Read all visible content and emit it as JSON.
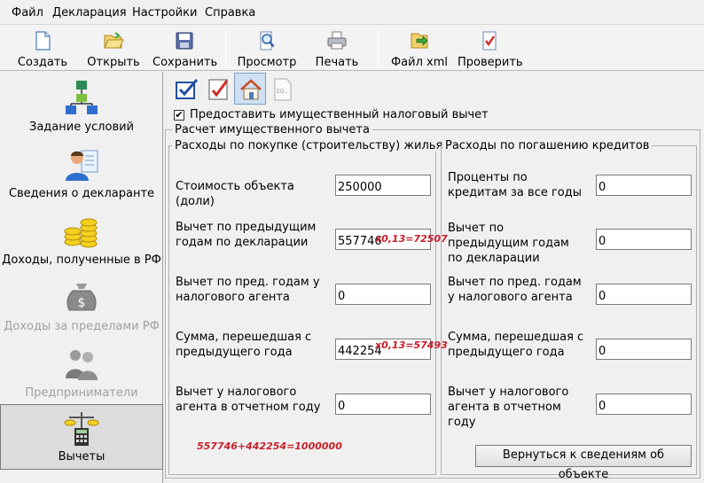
{
  "menu": [
    "Файл",
    "Декларация",
    "Настройки",
    "Справка"
  ],
  "toolbar": {
    "buttons": [
      {
        "label": "Создать",
        "icon": "new-document-icon"
      },
      {
        "label": "Открыть",
        "icon": "open-folder-icon"
      },
      {
        "label": "Сохранить",
        "icon": "save-floppy-icon"
      },
      {
        "label": "Просмотр",
        "icon": "preview-magnifier-icon"
      },
      {
        "label": "Печать",
        "icon": "printer-icon"
      },
      {
        "label": "Файл xml",
        "icon": "xml-file-icon"
      },
      {
        "label": "Проверить",
        "icon": "check-document-icon"
      }
    ]
  },
  "sidebar": {
    "items": [
      {
        "label": "Задание условий",
        "icon": "conditions-flowchart-icon",
        "state": "normal"
      },
      {
        "label": "Сведения о декларанте",
        "icon": "person-card-icon",
        "state": "normal"
      },
      {
        "label": "Доходы, полученные в РФ",
        "icon": "coin-stacks-icon",
        "state": "normal"
      },
      {
        "label": "Доходы за пределами РФ",
        "icon": "money-bag-icon",
        "state": "disabled"
      },
      {
        "label": "Предприниматели",
        "icon": "businessmen-icon",
        "state": "disabled"
      },
      {
        "label": "Вычеты",
        "icon": "scales-calculator-icon",
        "state": "active"
      }
    ]
  },
  "tabs": [
    {
      "icon": "standard-deduction-tab-icon"
    },
    {
      "icon": "social-deduction-tab-icon"
    },
    {
      "icon": "property-deduction-tab-icon",
      "active": true
    },
    {
      "icon": "other-deduction-tab-icon"
    }
  ],
  "property_deduction": {
    "checkbox_label": "Предоставить имущественный налоговый вычет",
    "checkbox_checked": true,
    "group_title": "Расчет имущественного вычета",
    "left": {
      "title": "Расходы по покупке (строительству) жилья",
      "fields": [
        {
          "label": "Стоимость объекта (доли)",
          "value": "250000"
        },
        {
          "label": "Вычет по предыдущим годам по декларации",
          "value": "557746"
        },
        {
          "label": "Вычет по пред. годам у налогового агента",
          "value": "0"
        },
        {
          "label": "Сумма, перешедшая с предыдущего года",
          "value": "442254"
        },
        {
          "label": "Вычет у налогового агента в отчетном году",
          "value": "0"
        }
      ]
    },
    "right": {
      "title": "Расходы по погашению кредитов",
      "fields": [
        {
          "label": "Проценты по кредитам за все годы",
          "value": "0"
        },
        {
          "label": "Вычет по предыдущим годам по декларации",
          "value": "0"
        },
        {
          "label": "Вычет по пред. годам у налогового агента",
          "value": "0"
        },
        {
          "label": "Сумма, перешедшая с предыдущего года",
          "value": "0"
        },
        {
          "label": "Вычет у налогового агента в отчетном году",
          "value": "0"
        }
      ]
    },
    "return_button": "Вернуться к сведениям об объекте"
  },
  "annotations": {
    "calc1": "x0,13=72507",
    "calc2": "x0,13=57493",
    "sum": "557746+442254=1000000",
    "color": "#c8202a"
  }
}
